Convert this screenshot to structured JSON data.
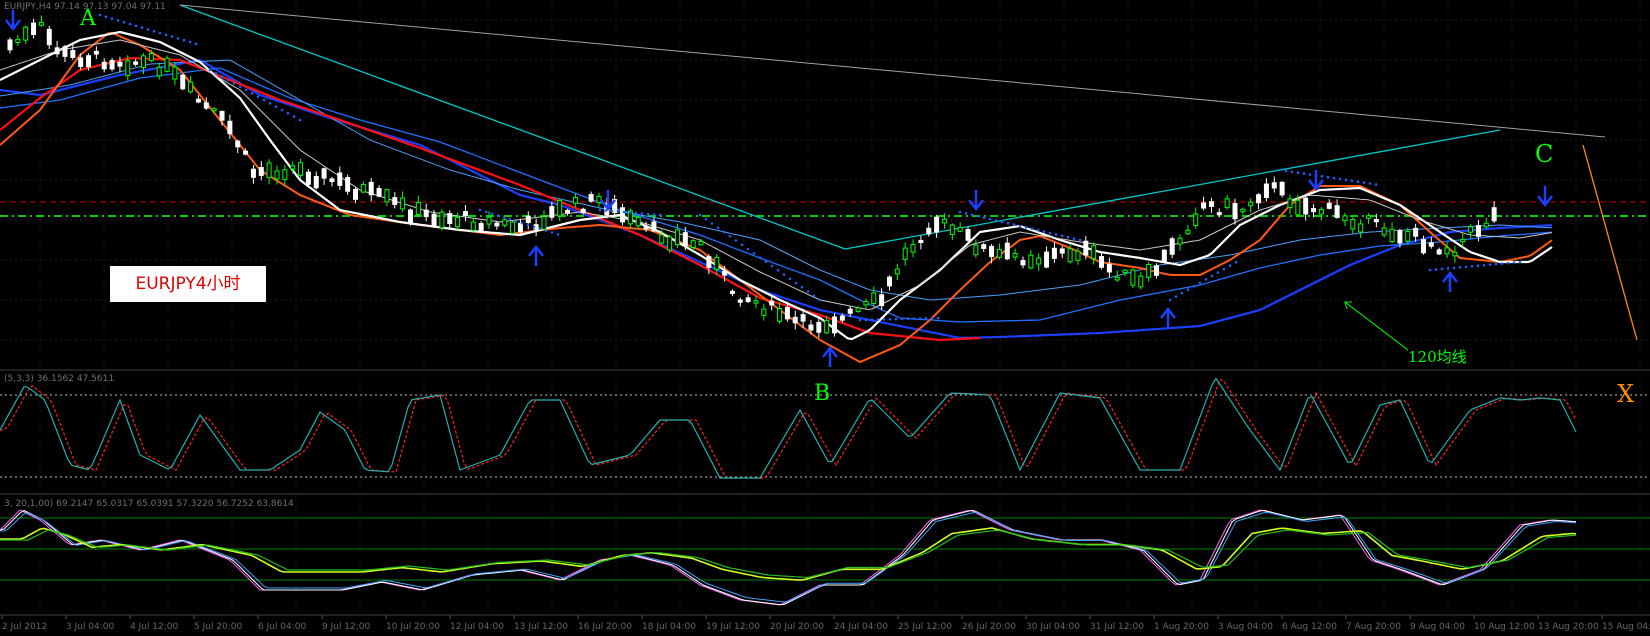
{
  "app": {
    "symbol_header": "EURJPY,H4  97.14 97.13 97.04 97.11"
  },
  "annotations": {
    "point_a": "A",
    "point_b": "B",
    "point_c": "C",
    "point_x": "X",
    "chart_label": "EURJPY4小时",
    "ma_note": "120均线"
  },
  "indicators": {
    "osc1_header": "(5,3,3) 36.1562 47.5611",
    "osc2_header": "3, 20,1,00) 69.2147 65.0317 65.0391 57.3220 56.7252 63.8614"
  },
  "x_axis": {
    "labels": [
      "2 Jul 2012",
      "3 Jul 04:00",
      "4 Jul 12:00",
      "5 Jul 20:00",
      "6 Jul 04:00",
      "9 Jul 12:00",
      "10 Jul 20:00",
      "12 Jul 04:00",
      "13 Jul 12:00",
      "16 Jul 20:00",
      "18 Jul 04:00",
      "19 Jul 12:00",
      "20 Jul 20:00",
      "24 Jul 04:00",
      "25 Jul 12:00",
      "26 Jul 20:00",
      "30 Jul 04:00",
      "31 Jul 12:00",
      "1 Aug 20:00",
      "3 Aug 04:00",
      "6 Aug 12:00",
      "7 Aug 20:00",
      "9 Aug 04:00",
      "10 Aug 12:00",
      "13 Aug 20:00",
      "15 Aug 04:00"
    ]
  },
  "colors": {
    "background": "#000000",
    "bull_candle": "#00ff00",
    "bear_candle": "#ffffff",
    "ma_fast": "#ff5a14",
    "ma_red": "#ff0000",
    "ma_white": "#ffffff",
    "ma_blue": "#1e90ff",
    "ma_120": "#1010ff",
    "trendline": "#00c8c8",
    "long_trendline": "#a0a0a0",
    "projection": "#ff8c00",
    "label_green": "#00ff00",
    "label_orange": "#ff8c00"
  },
  "chart_data": {
    "type": "candlestick",
    "symbol": "EURJPY",
    "timeframe": "H4",
    "series": [
      {
        "name": "A",
        "value": 100.9
      },
      {
        "name": "B",
        "value": 94.6
      },
      {
        "name": "C",
        "value": 98.2
      }
    ]
  }
}
